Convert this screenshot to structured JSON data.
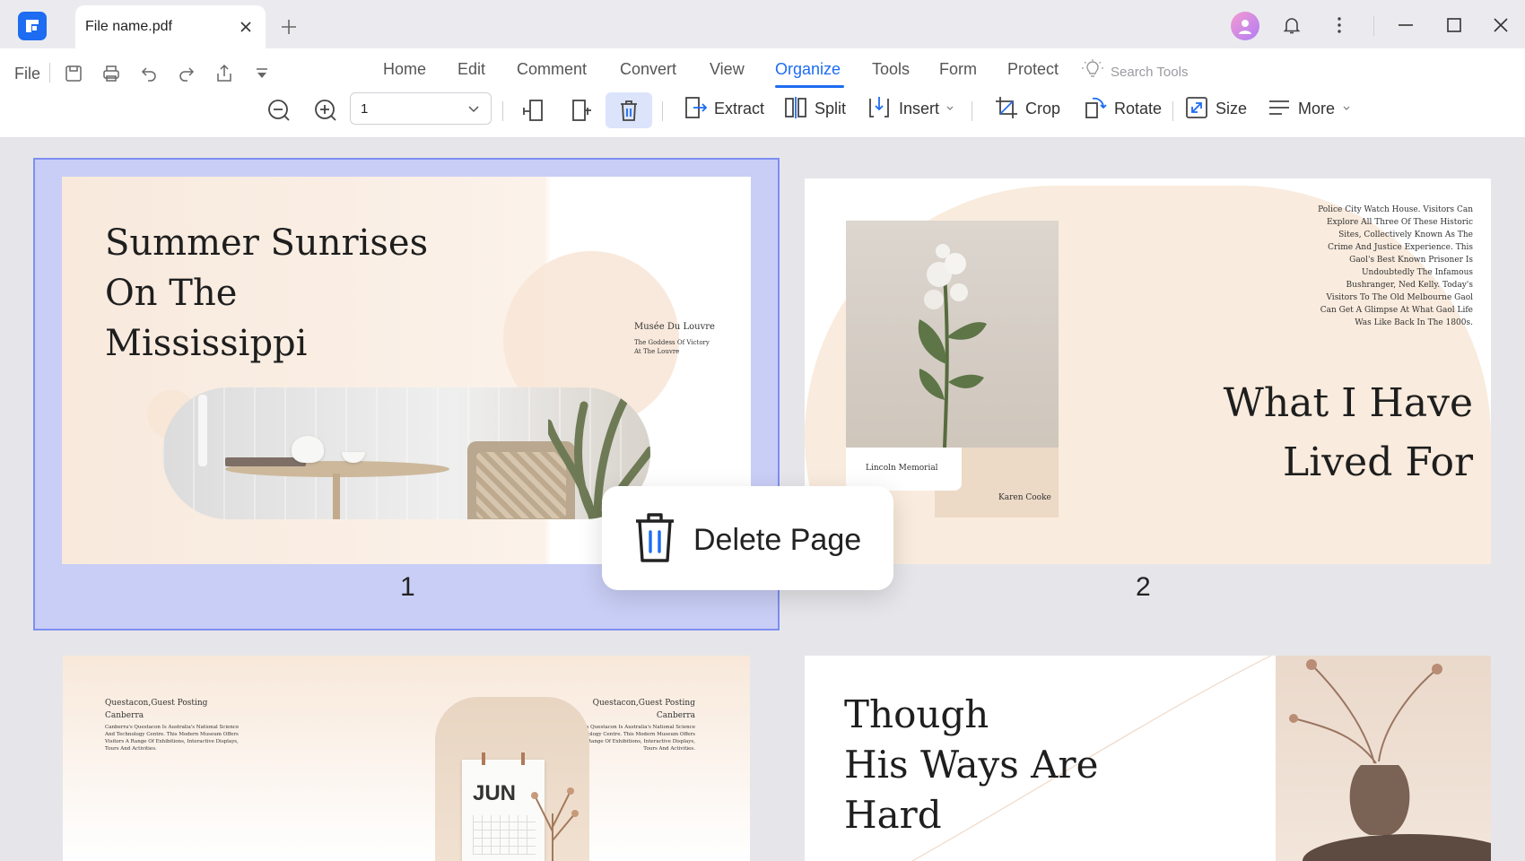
{
  "window": {
    "tab_title": "File name.pdf"
  },
  "toolbar": {
    "file_label": "File",
    "nav_tabs": [
      "Home",
      "Edit",
      "Comment",
      "Convert",
      "View",
      "Organize",
      "Tools",
      "Form",
      "Protect"
    ],
    "active_tab": "Organize",
    "search_placeholder": "Search Tools",
    "page_select_value": "1",
    "buttons": {
      "extract": "Extract",
      "split": "Split",
      "insert": "Insert",
      "crop": "Crop",
      "rotate": "Rotate",
      "size": "Size",
      "more": "More"
    }
  },
  "accent_color": "#1d6cf2",
  "pages": [
    {
      "number": "1",
      "selected": true,
      "title_lines": [
        "Summer Sunrises",
        "On The",
        "Mississippi"
      ],
      "caption_title": "Musée Du Louvre",
      "caption_lines": [
        "The Goddess Of Victory",
        "At The Louvre"
      ]
    },
    {
      "number": "2",
      "selected": false,
      "body_lines": [
        "Police City Watch House. Visitors Can",
        "Explore All Three Of These Historic",
        "Sites, Collectively Known As The",
        "Crime And Justice Experience. This",
        "Gaol's Best Known Prisoner Is",
        "Undoubtedly The Infamous",
        "Bushranger, Ned Kelly. Today's",
        "Visitors To The Old Melbourne Gaol",
        "Can Get A Glimpse At What Gaol Life",
        "Was Like Back In The 1800s."
      ],
      "card_label": "Lincoln Memorial",
      "card_author": "Karen Cooke",
      "title_lines": [
        "What I Have",
        "Lived For"
      ]
    },
    {
      "left_heading": [
        "Questacon,Guest Posting",
        "Canberra"
      ],
      "left_body": [
        "Canberra's Questacon Is Australia's National Science",
        "And Technology Centre. This Modern Museum Offers",
        "Visitors A Range Of Exhibitions, Interactive Displays,",
        "Tours And Activities."
      ],
      "right_heading": [
        "Questacon,Guest Posting",
        "Canberra"
      ],
      "right_body": [
        "Canberra's Questacon Is Australia's National Science",
        "And Technology Centre. This Modern Museum Offers",
        "Visitors A Range Of Exhibitions, Interactive Displays,",
        "Tours And Activities."
      ],
      "calendar_month": "JUN"
    },
    {
      "title_lines": [
        "Though",
        "His Ways Are",
        "Hard"
      ]
    }
  ],
  "popup": {
    "label": "Delete Page"
  }
}
